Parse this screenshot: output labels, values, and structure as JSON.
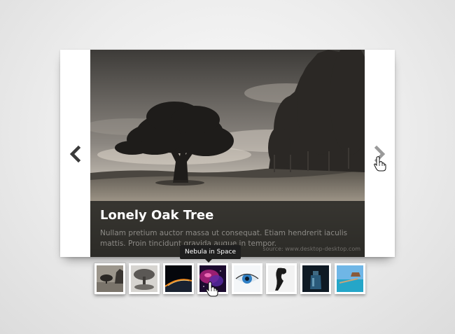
{
  "slide": {
    "title": "Lonely Oak Tree",
    "description": "Nullam pretium auctor massa ut consequat. Etiam hendrerit iaculis mattis. Proin tincidunt gravida augue in tempor.",
    "watermark": "source: www.desktop-desktop.com"
  },
  "tooltip": {
    "text": "Nebula in Space"
  },
  "thumbnails": [
    {
      "name": "lonely-oak-tree",
      "active": true
    },
    {
      "name": "stone-tree"
    },
    {
      "name": "planet-horizon"
    },
    {
      "name": "nebula-in-space"
    },
    {
      "name": "blue-eye"
    },
    {
      "name": "fashion-silhouette"
    },
    {
      "name": "blue-bottle"
    },
    {
      "name": "beach-pier"
    }
  ],
  "icons": {
    "prev": "chevron-left-icon",
    "next": "chevron-right-icon",
    "cursor": "hand-pointer-icon"
  },
  "colors": {
    "caption_bg": "#1c1b19",
    "caption_title": "#ffffff",
    "caption_text": "#8c8a86",
    "arrow_prev": "#3a3a3a",
    "arrow_next": "#9a9a9a"
  }
}
